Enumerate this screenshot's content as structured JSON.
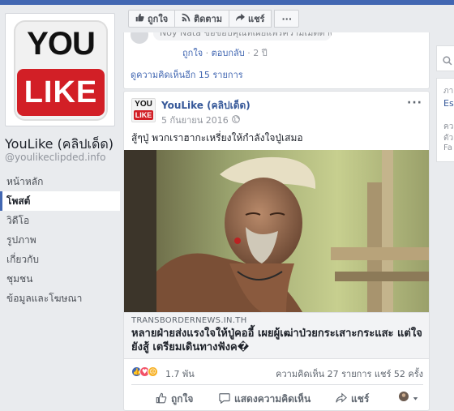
{
  "page": {
    "name": "YouLike (คลิปเด็ด)",
    "handle": "@youlikeclipded.info",
    "logo_top": "YOU",
    "logo_bottom": "LIKE"
  },
  "nav": {
    "items": [
      {
        "label": "หน้าหลัก",
        "active": false
      },
      {
        "label": "โพสต์",
        "active": true
      },
      {
        "label": "วิดีโอ",
        "active": false
      },
      {
        "label": "รูปภาพ",
        "active": false
      },
      {
        "label": "เกี่ยวกับ",
        "active": false
      },
      {
        "label": "ชุมชน",
        "active": false
      },
      {
        "label": "ข้อมูลและโฆษณา",
        "active": false
      }
    ]
  },
  "action_bar": {
    "like": "ถูกใจ",
    "follow": "ติดตาม",
    "share": "แชร์",
    "more": "···"
  },
  "comment_preview": {
    "text": "Noy Nata ขอขอบคุณที่เผยแพร่ความเมตตาครับผม",
    "like": "ถูกใจ",
    "reply": "ตอบกลับ",
    "time": "2 ปี",
    "more_comments": "ดูความคิดเห็นอีก 15 รายการ"
  },
  "post": {
    "author": "YouLike (คลิปเด็ด)",
    "date": "5 กันยายน 2016",
    "text": "สู้ๆปู่ พวกเราฮากะเหรี่ยงให้กำลังใจปู่เสมอ",
    "link_domain": "TRANSBORDERNEWS.IN.TH",
    "link_title": "หลายฝ่ายส่งแรงใจให้ปู่คออี้ เผยผู้เฒ่าป่วยกระเสาะกระแสะ แต่ใจยังสู้ เตรียมเดินทางฟังค�",
    "reactions_count": "1.7 พัน",
    "comments_count": "ความคิดเห็น 27 รายการ",
    "shares_count": "แชร์ 52 ครั้ง",
    "actions": {
      "like": "ถูกใจ",
      "comment": "แสดงความคิดเห็น",
      "share": "แชร์"
    }
  },
  "right_panel": {
    "lines": [
      "ภา",
      "Es",
      "คว",
      "ตัว",
      "Fa"
    ]
  },
  "colors": {
    "brand_blue": "#4267b2",
    "link_blue": "#365899",
    "logo_red": "#d21f26"
  }
}
